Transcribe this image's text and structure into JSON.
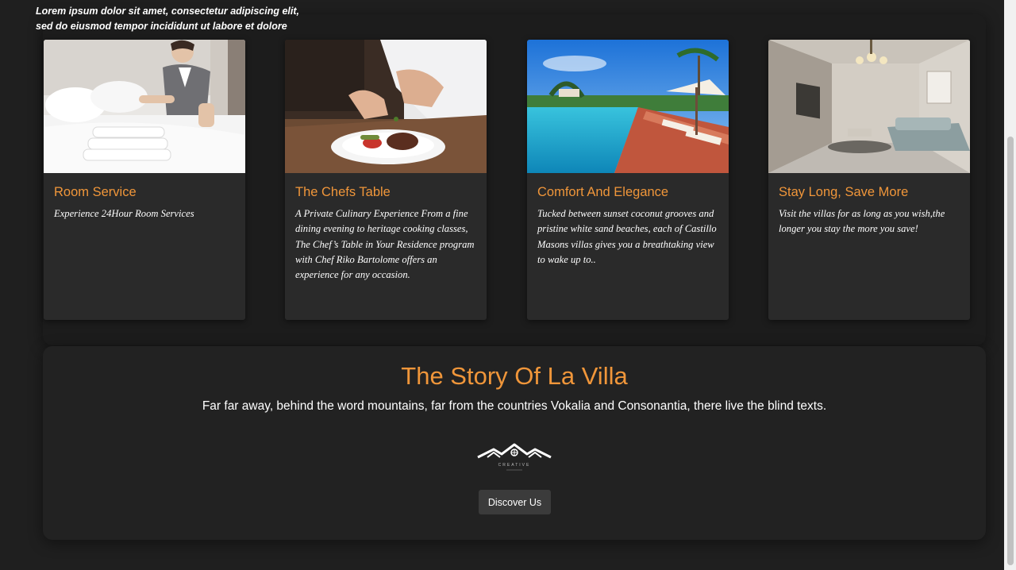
{
  "overlay_text": {
    "line1": "Lorem ipsum dolor sit amet, consectetur adipiscing elit,",
    "line2": "sed do eiusmod tempor incididunt ut labore et dolore"
  },
  "services": [
    {
      "image_icon": "room-service-photo",
      "title": "Room Service",
      "text": "Experience 24Hour Room Services"
    },
    {
      "image_icon": "chef-plating-photo",
      "title": "The Chefs Table",
      "text": "A Private Culinary Experience From a fine dining evening to heritage cooking classes, The Chef’s Table in Your Residence program with Chef Riko Bartolome offers an experience for any occasion."
    },
    {
      "image_icon": "pool-resort-photo",
      "title": "Comfort And Elegance",
      "text": "Tucked between sunset coconut grooves and pristine white sand beaches, each of Castillo Masons villas gives you a breathtaking view to wake up to.."
    },
    {
      "image_icon": "living-room-photo",
      "title": "Stay Long, Save More",
      "text": "Visit the villas for as long as you wish,the longer you stay the more you save!"
    }
  ],
  "story": {
    "title": "The Story Of La Villa",
    "subtitle": "Far far away, behind the word mountains, far from the countries Vokalia and Consonantia, there live the blind texts.",
    "logo_icon": "creative-house-logo",
    "logo_text": "CREATIVE",
    "button_label": "Discover Us"
  },
  "colors": {
    "accent": "#f0963a",
    "background": "#1f1f1f",
    "card": "#2a2a2a",
    "button": "#3b3b3b"
  }
}
